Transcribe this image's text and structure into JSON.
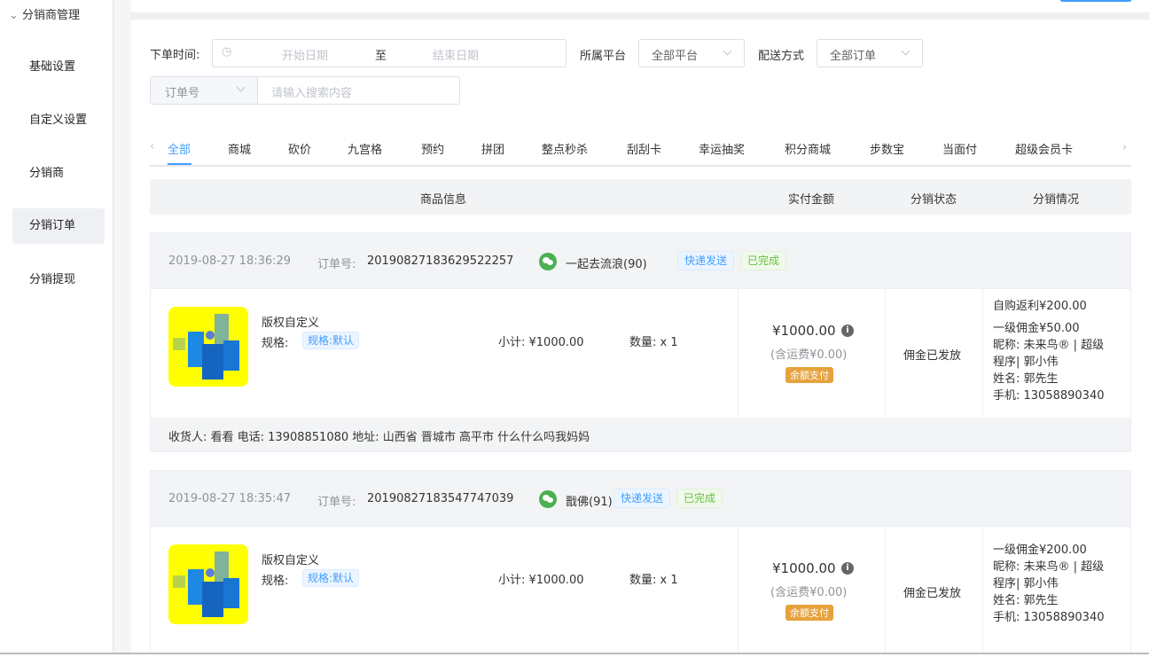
{
  "sidebar": {
    "group": "分销商管理",
    "items": [
      "基础设置",
      "自定义设置",
      "分销商",
      "分销订单",
      "分销提现"
    ],
    "active": "分销订单"
  },
  "filters": {
    "time_label": "下单时间:",
    "start_ph": "开始日期",
    "to": "至",
    "end_ph": "结束日期",
    "platform_label": "所属平台",
    "platform_value": "全部平台",
    "delivery_label": "配送方式",
    "delivery_value": "全部订单",
    "search_type": "订单号",
    "search_ph": "请输入搜索内容"
  },
  "tabs": [
    "全部",
    "商城",
    "砍价",
    "九宫格",
    "预约",
    "拼团",
    "整点秒杀",
    "刮刮卡",
    "幸运抽奖",
    "积分商城",
    "步数宝",
    "当面付",
    "超级会员卡"
  ],
  "table_head": {
    "goods": "商品信息",
    "amount": "实付金额",
    "status": "分销状态",
    "detail": "分销情况"
  },
  "orders": [
    {
      "time": "2019-08-27 18:36:29",
      "no_label": "订单号:",
      "no": "20190827183629522257",
      "user": "一起去流浪(90)",
      "tag1": "快递发送",
      "tag2": "已完成",
      "goods": "版权自定义",
      "spec_label": "规格:",
      "spec": "规格:默认",
      "subtotal": "小计: ¥1000.00",
      "qty": "数量: x 1",
      "amount": "¥1000.00",
      "freight": "(含运费¥0.00)",
      "pay": "余额支付",
      "status": "佣金已发放",
      "detail": [
        "自购返利¥200.00",
        "一级佣金¥50.00",
        "昵称: 未来鸟® | 超级",
        "程序| 郭小伟",
        "姓名: 郭先生",
        "手机: 13058890340"
      ],
      "address": "收货人: 看看 电话: 13908851080 地址: 山西省 晋城市 高平市 什么什么吗我妈妈"
    },
    {
      "time": "2019-08-27 18:35:47",
      "no_label": "订单号:",
      "no": "20190827183547747039",
      "user": "戬佛(91)",
      "tag1": "快递发送",
      "tag2": "已完成",
      "goods": "版权自定义",
      "spec_label": "规格:",
      "spec": "规格:默认",
      "subtotal": "小计: ¥1000.00",
      "qty": "数量: x 1",
      "amount": "¥1000.00",
      "freight": "(含运费¥0.00)",
      "pay": "余额支付",
      "status": "佣金已发放",
      "detail": [
        "一级佣金¥200.00",
        "昵称: 未来鸟® | 超级",
        "程序| 郭小伟",
        "姓名: 郭先生",
        "手机: 13058890340"
      ]
    }
  ]
}
